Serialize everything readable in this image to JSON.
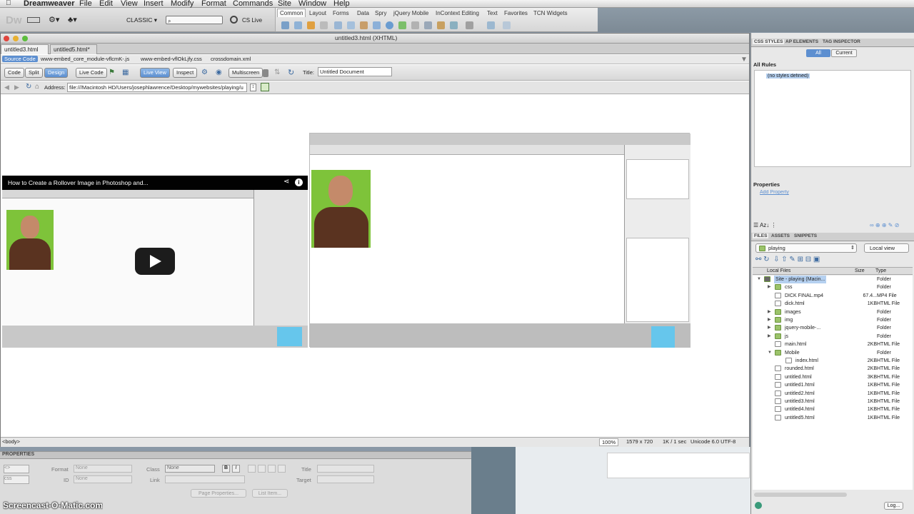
{
  "menubar": {
    "app": "Dreamweaver",
    "items": [
      "File",
      "Edit",
      "View",
      "Insert",
      "Modify",
      "Format",
      "Commands",
      "Site",
      "Window",
      "Help"
    ]
  },
  "appbar": {
    "logo": "Dw",
    "workspace": "CLASSIC",
    "search_placeholder": "",
    "cslive": "CS Live"
  },
  "insertbar": {
    "tabs": [
      "Common",
      "Layout",
      "Forms",
      "Data",
      "Spry",
      "jQuery Mobile",
      "InContext Editing",
      "Text",
      "Favorites",
      "TCN Widgets"
    ],
    "active": "Common"
  },
  "document": {
    "window_title": "untitled3.html (XHTML)",
    "tabs": [
      "untitled3.html",
      "untitled5.html*"
    ],
    "related": [
      "Source Code",
      "www-embed_core_module-vflcmK-.js",
      "www-embed-vflOkLjfy.css",
      "crossdomain.xml"
    ],
    "toolbar": {
      "code": "Code",
      "split": "Split",
      "design": "Design",
      "live_code": "Live Code",
      "live_view": "Live View",
      "inspect": "Inspect",
      "multiscreen": "Multiscreen",
      "title_label": "Title:",
      "title_value": "Untitled Document"
    },
    "address": {
      "label": "Address:",
      "value": "file:///Macintosh HD/Users/josephlawrence/Desktop/mywebsites/playing/u"
    },
    "video": {
      "title": "How to Create a Rollover Image in Photoshop and..."
    },
    "status": {
      "tag": "<body>",
      "zoom": "100%",
      "size": "1579 x 720",
      "download": "1K / 1 sec",
      "encoding": "Unicode 6.0 UTF-8"
    }
  },
  "properties": {
    "header": "PROPERTIES",
    "format_label": "Format",
    "format_value": "None",
    "class_label": "Class",
    "class_value": "None",
    "id_label": "ID",
    "id_value": "None",
    "link_label": "Link",
    "title_label": "Title",
    "target_label": "Target",
    "page_properties": "Page Properties...",
    "list_item": "List Item..."
  },
  "css_panel": {
    "tabs": [
      "CSS STYLES",
      "AP ELEMENTS",
      "TAG INSPECTOR"
    ],
    "all": "All",
    "current": "Current",
    "all_rules": "All Rules",
    "no_styles": "(no styles defined)",
    "properties": "Properties",
    "add_property": "Add Property"
  },
  "files_panel": {
    "tabs": [
      "FILES",
      "ASSETS",
      "SNIPPETS"
    ],
    "site": "playing",
    "view": "Local view",
    "col_local": "Local Files",
    "col_size": "Size",
    "col_type": "Type",
    "log": "Log...",
    "rows": [
      {
        "name": "Site - playing (Macin...",
        "size": "",
        "type": "Folder",
        "kind": "site",
        "indent": 0,
        "tw": "▼"
      },
      {
        "name": "css",
        "size": "",
        "type": "Folder",
        "kind": "folder",
        "indent": 1,
        "tw": "▶"
      },
      {
        "name": "DICK FINAL.mp4",
        "size": "67.4...",
        "type": "MP4 File",
        "kind": "file",
        "indent": 1,
        "tw": ""
      },
      {
        "name": "dick.html",
        "size": "1KB",
        "type": "HTML File",
        "kind": "file",
        "indent": 1,
        "tw": ""
      },
      {
        "name": "images",
        "size": "",
        "type": "Folder",
        "kind": "folder",
        "indent": 1,
        "tw": "▶"
      },
      {
        "name": "img",
        "size": "",
        "type": "Folder",
        "kind": "folder",
        "indent": 1,
        "tw": "▶"
      },
      {
        "name": "jquery-mobile-...",
        "size": "",
        "type": "Folder",
        "kind": "folder",
        "indent": 1,
        "tw": "▶"
      },
      {
        "name": "js",
        "size": "",
        "type": "Folder",
        "kind": "folder",
        "indent": 1,
        "tw": "▶"
      },
      {
        "name": "main.html",
        "size": "2KB",
        "type": "HTML File",
        "kind": "file",
        "indent": 1,
        "tw": ""
      },
      {
        "name": "Mobile",
        "size": "",
        "type": "Folder",
        "kind": "folder",
        "indent": 1,
        "tw": "▼"
      },
      {
        "name": "index.html",
        "size": "2KB",
        "type": "HTML File",
        "kind": "file",
        "indent": 2,
        "tw": ""
      },
      {
        "name": "rounded.html",
        "size": "2KB",
        "type": "HTML File",
        "kind": "file",
        "indent": 1,
        "tw": ""
      },
      {
        "name": "untitled.html",
        "size": "3KB",
        "type": "HTML File",
        "kind": "file",
        "indent": 1,
        "tw": ""
      },
      {
        "name": "untitled1.html",
        "size": "1KB",
        "type": "HTML File",
        "kind": "file",
        "indent": 1,
        "tw": ""
      },
      {
        "name": "untitled2.html",
        "size": "1KB",
        "type": "HTML File",
        "kind": "file",
        "indent": 1,
        "tw": ""
      },
      {
        "name": "untitled3.html",
        "size": "1KB",
        "type": "HTML File",
        "kind": "file",
        "indent": 1,
        "tw": ""
      },
      {
        "name": "untitled4.html",
        "size": "1KB",
        "type": "HTML File",
        "kind": "file",
        "indent": 1,
        "tw": ""
      },
      {
        "name": "untitled5.html",
        "size": "1KB",
        "type": "HTML File",
        "kind": "file",
        "indent": 1,
        "tw": ""
      }
    ]
  },
  "watermark": "Screencast-O-Matic.com",
  "colors": {
    "accent": "#5d8fd0",
    "selection": "#b5d0f0",
    "folder": "#9bc36a",
    "youtube_red": "#000000",
    "photo_bg": "#7ec33a"
  }
}
